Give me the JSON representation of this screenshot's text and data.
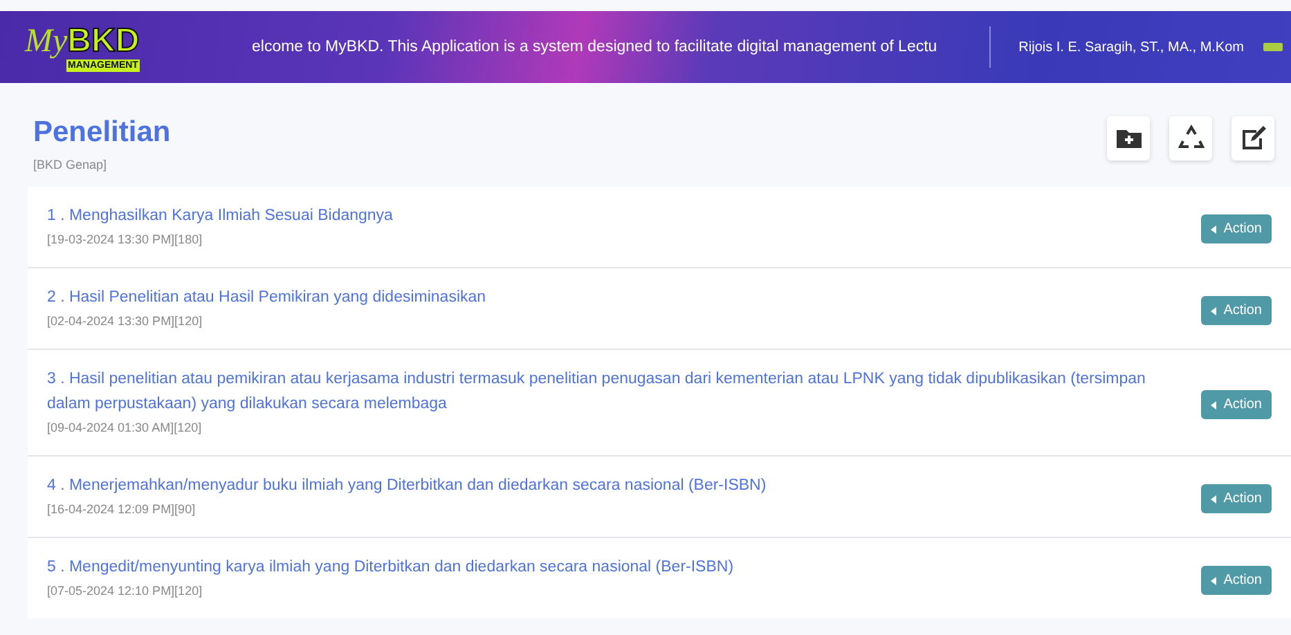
{
  "header": {
    "logo": {
      "script": "My",
      "mark": "BKD",
      "tagline": "MANAGEMENT"
    },
    "marquee": "elcome to MyBKD. This Application is a system designed to facilitate digital management of Lectu",
    "user": "Rijois I. E. Saragih, ST., MA., M.Kom"
  },
  "page": {
    "title": "Penelitian",
    "subtitle": "[BKD Genap]"
  },
  "toolbar": [
    {
      "kind": "add-folder"
    },
    {
      "kind": "recycle"
    },
    {
      "kind": "edit"
    }
  ],
  "items": [
    {
      "title": "1 . Menghasilkan Karya Ilmiah Sesuai Bidangnya",
      "meta": "[19-03-2024 13:30 PM][180]",
      "action": "Action"
    },
    {
      "title": "2 . Hasil Penelitian atau Hasil Pemikiran yang didesiminasikan",
      "meta": "[02-04-2024 13:30 PM][120]",
      "action": "Action"
    },
    {
      "title": "3 . Hasil penelitian atau pemikiran atau kerjasama industri termasuk penelitian penugasan dari kementerian atau LPNK yang tidak dipublikasikan (tersimpan dalam perpustakaan) yang dilakukan secara melembaga",
      "meta": "[09-04-2024 01:30 AM][120]",
      "action": "Action"
    },
    {
      "title": "4 . Menerjemahkan/menyadur buku ilmiah yang Diterbitkan dan diedarkan secara nasional (Ber-ISBN)",
      "meta": "[16-04-2024 12:09 PM][90]",
      "action": "Action"
    },
    {
      "title": "5 . Mengedit/menyunting karya ilmiah yang Diterbitkan dan diedarkan secara nasional (Ber-ISBN)",
      "meta": "[07-05-2024 12:10 PM][120]",
      "action": "Action"
    }
  ]
}
